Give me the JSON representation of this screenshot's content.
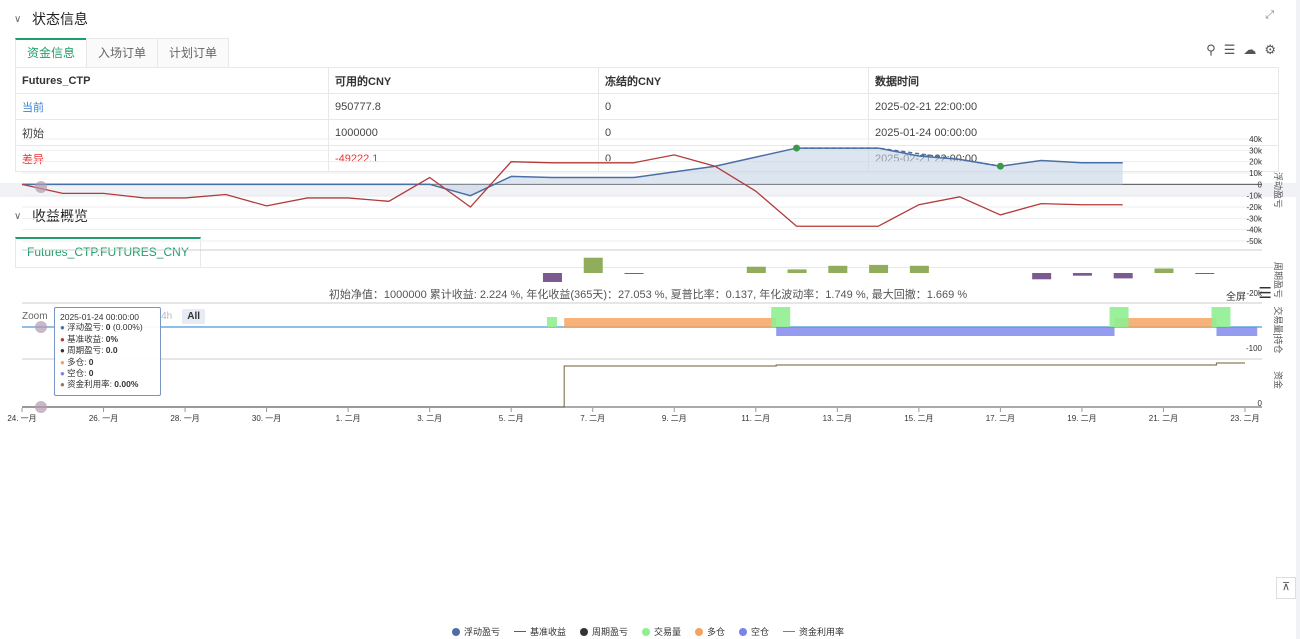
{
  "status": {
    "title": "状态信息",
    "tabs": [
      "资金信息",
      "入场订单",
      "计划订单"
    ],
    "table": {
      "headers": [
        "Futures_CTP",
        "可用的CNY",
        "冻结的CNY",
        "数据时间"
      ],
      "rows": [
        [
          "当前",
          "950777.8",
          "0",
          "2025-02-21 22:00:00"
        ],
        [
          "初始",
          "1000000",
          "0",
          "2025-01-24 00:00:00"
        ],
        [
          "差异",
          "-49222.1",
          "0",
          "2025-02-21 22:00:00"
        ]
      ]
    }
  },
  "profit": {
    "title": "收益概览",
    "tab": "Futures_CTP.FUTURES_CNY",
    "summary": "初始净值：1000000 累计收益: 2.224 %, 年化收益(365天)：27.053 %, 夏普比率：0.137, 年化波动率：1.749 %, 最大回撤：1.669 %",
    "fullscreen": "全屏",
    "zoom_label": "Zoom",
    "zoom_buttons": [
      "24h",
      "All"
    ]
  },
  "tooltip": {
    "date": "2025-01-24 00:00:00",
    "rows": [
      {
        "label": "浮动盈亏: ",
        "value": "0",
        "extra": " (0.00%)",
        "color": "#4a6fa5"
      },
      {
        "label": "基准收益: ",
        "value": "0%",
        "extra": "",
        "color": "#b23a3a"
      },
      {
        "label": "周期盈亏: ",
        "value": "0.0",
        "extra": "",
        "color": "#333333"
      },
      {
        "label": "多仓: ",
        "value": "0",
        "extra": "",
        "color": "#f4a460"
      },
      {
        "label": "空仓: ",
        "value": "0",
        "extra": "",
        "color": "#7b83eb"
      },
      {
        "label": "资金利用率: ",
        "value": "0.00%",
        "extra": "",
        "color": "#8b7d5a"
      }
    ]
  },
  "legend": [
    {
      "label": "浮动盈亏",
      "color": "#4a6fa5",
      "kind": "dot"
    },
    {
      "label": "基准收益",
      "color": "#b23a3a",
      "kind": "line"
    },
    {
      "label": "周期盈亏",
      "color": "#333333",
      "kind": "dot"
    },
    {
      "label": "交易量",
      "color": "#90ee90",
      "kind": "dot"
    },
    {
      "label": "多仓",
      "color": "#f4a460",
      "kind": "dot"
    },
    {
      "label": "空仓",
      "color": "#7b83eb",
      "kind": "dot"
    },
    {
      "label": "资金利用率",
      "color": "#8b7d5a",
      "kind": "line"
    }
  ],
  "chart_data": {
    "type": "line",
    "x": [
      "2025-01-24",
      "2025-01-25",
      "2025-01-26",
      "2025-01-27",
      "2025-01-28",
      "2025-01-29",
      "2025-01-30",
      "2025-01-31",
      "2025-02-01",
      "2025-02-02",
      "2025-02-03",
      "2025-02-04",
      "2025-02-05",
      "2025-02-06",
      "2025-02-07",
      "2025-02-08",
      "2025-02-09",
      "2025-02-10",
      "2025-02-11",
      "2025-02-12",
      "2025-02-13",
      "2025-02-14",
      "2025-02-15",
      "2025-02-16",
      "2025-02-17",
      "2025-02-18",
      "2025-02-19",
      "2025-02-20",
      "2025-02-21",
      "2025-02-22",
      "2025-02-23"
    ],
    "x_ticks": [
      "24. 一月",
      "26. 一月",
      "28. 一月",
      "30. 一月",
      "1. 二月",
      "3. 二月",
      "5. 二月",
      "7. 二月",
      "9. 二月",
      "11. 二月",
      "13. 二月",
      "15. 二月",
      "17. 二月",
      "19. 二月",
      "21. 二月",
      "23. 二月"
    ],
    "panes": [
      {
        "ylabel": "浮动盈亏",
        "yticks": [
          "40k",
          "30k",
          "20k",
          "10k",
          "0",
          "-10k",
          "-20k",
          "-30k",
          "-40k",
          "-50k"
        ],
        "ylim": [
          -50000,
          40000
        ],
        "series": [
          {
            "name": "浮动盈亏",
            "values": [
              0,
              0,
              0,
              0,
              0,
              0,
              0,
              0,
              0,
              0,
              0,
              -10000,
              7000,
              6000,
              6000,
              6000,
              11000,
              16000,
              24000,
              32000,
              32000,
              32000,
              25000,
              22000,
              16000,
              21000,
              19000,
              19000
            ]
          },
          {
            "name": "基准收益",
            "values": [
              0,
              -8000,
              -8000,
              -12000,
              -12000,
              -9000,
              -19000,
              -12000,
              -12000,
              -15000,
              6000,
              -20000,
              20000,
              19000,
              19000,
              19000,
              26000,
              16000,
              -6000,
              -37000,
              -37000,
              -37000,
              -18000,
              -11000,
              -27000,
              -17000,
              -18000,
              -18000
            ]
          }
        ]
      },
      {
        "ylabel": "周期盈亏",
        "yticks": [
          "-20k"
        ],
        "bars": [
          -10000,
          17000,
          -1000,
          7000,
          4000,
          8000,
          9000,
          8000,
          -7000,
          -3000,
          -6000,
          5000,
          -1000
        ]
      },
      {
        "ylabel": "交易量|持仓",
        "yticks": [
          "-100"
        ],
        "long": [
          [
            13.3,
            18.5
          ],
          [
            26.8,
            29.3
          ]
        ],
        "short": [
          [
            18.5,
            26.8
          ],
          [
            29.3,
            30.3
          ]
        ]
      },
      {
        "ylabel": "资金",
        "yticks": [
          "0"
        ],
        "util": "step"
      }
    ]
  }
}
